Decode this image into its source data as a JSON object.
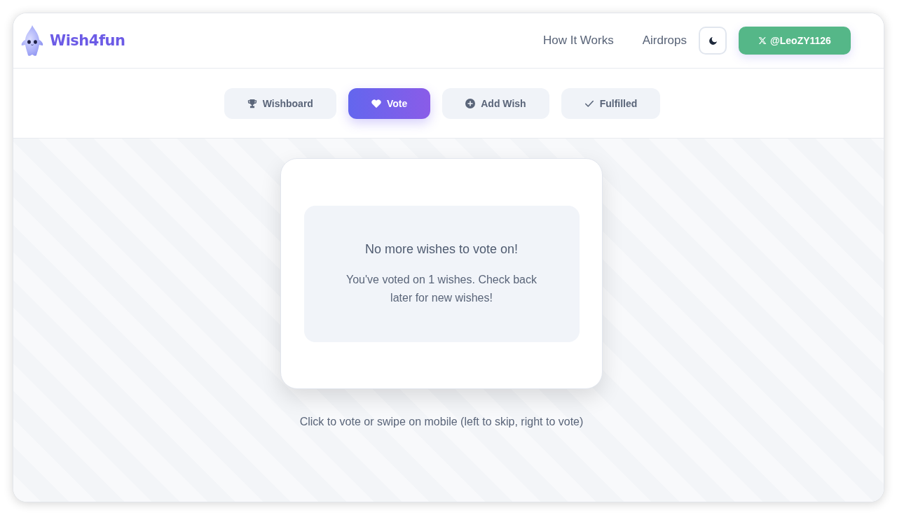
{
  "header": {
    "logo": {
      "text": "Wish4fun"
    },
    "nav": [
      {
        "label": "How It Works"
      },
      {
        "label": "Airdrops"
      }
    ],
    "account_button": {
      "label": "@LeoZY1126"
    }
  },
  "tabs": [
    {
      "label": "Wishboard",
      "selected": false
    },
    {
      "label": "Vote",
      "selected": true
    },
    {
      "label": "Add Wish",
      "selected": false
    },
    {
      "label": "Fulfilled",
      "selected": false
    }
  ],
  "vote_card": {
    "title": "No more wishes to vote on!",
    "message": "You've voted on 1 wishes. Check back later for new wishes!"
  },
  "hint": "Click to vote or swipe on mobile (left to skip, right to vote)"
}
